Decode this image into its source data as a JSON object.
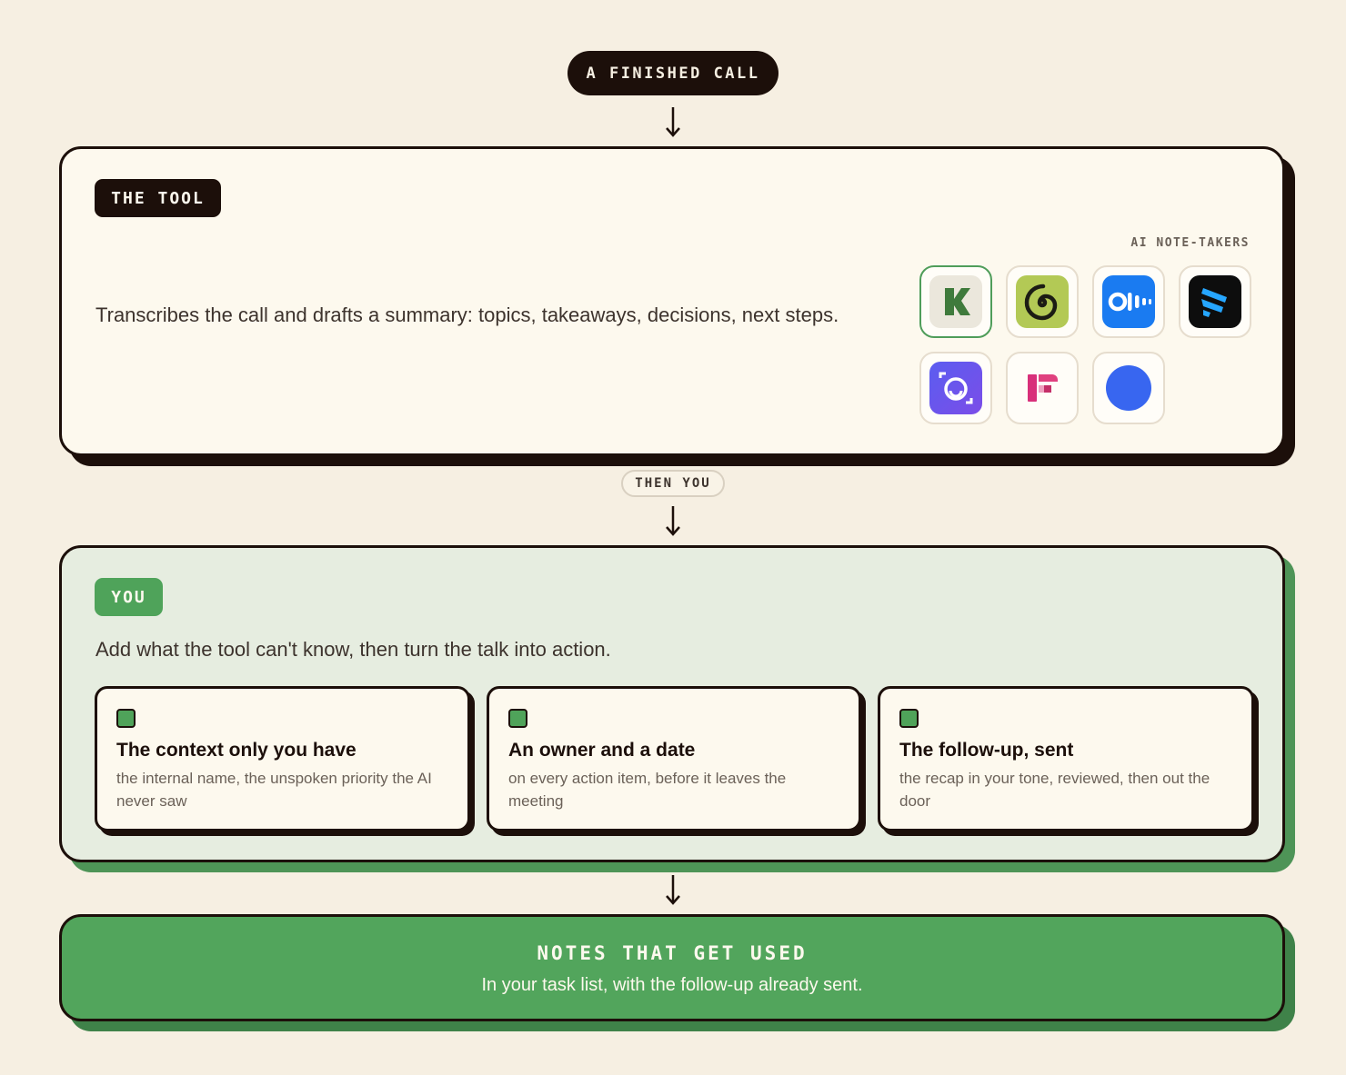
{
  "start": {
    "label": "A FINISHED CALL"
  },
  "tool": {
    "tag": "THE TOOL",
    "description": "Transcribes the call and drafts a summary: topics, takeaways, decisions, next steps.",
    "logos_label": "AI NOTE-TAKERS",
    "logos": [
      "k-logo-icon",
      "spiral-logo-icon",
      "otter-logo-icon",
      "stripes-logo-icon",
      "camera-scan-logo-icon",
      "f-blocks-logo-icon",
      "blue-circle-logo-icon"
    ]
  },
  "connector": {
    "label": "THEN YOU"
  },
  "you": {
    "tag": "YOU",
    "description": "Add what the tool can't know, then turn the talk into action.",
    "cards": [
      {
        "title": "The context only you have",
        "body": "the internal name, the unspoken priority the AI never saw"
      },
      {
        "title": "An owner and a date",
        "body": "on every action item, before it leaves the meeting"
      },
      {
        "title": "The follow-up, sent",
        "body": "the recap in your tone, reviewed, then out the door"
      }
    ]
  },
  "result": {
    "title": "NOTES THAT GET USED",
    "subtitle": "In your task list, with the follow-up already sent."
  },
  "colors": {
    "background": "#f6efe2",
    "dark": "#1c0f0a",
    "green": "#4fa35a",
    "you_panel": "#e6ede0"
  }
}
